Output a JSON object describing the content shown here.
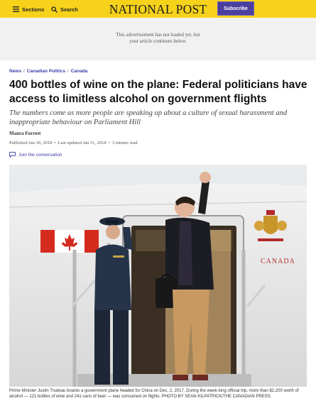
{
  "header": {
    "sections_label": "Sections",
    "search_label": "Search",
    "logo_text": "NATIONAL POST",
    "subscribe_label": "Subscribe",
    "accent_color": "#f6d21b",
    "subscribe_color": "#4b3f9e"
  },
  "ad": {
    "line1": "This advertisement has not loaded yet, but",
    "line2": "your article continues below."
  },
  "breadcrumb": [
    "News",
    "Canadian Politics",
    "Canada"
  ],
  "article": {
    "headline": "400 bottles of wine on the plane: Federal politicians have access to limitless alcohol on government flights",
    "subhead": "The numbers come as more people are speaking up about a culture of sexual harassment and inappropriate behaviour on Parliament Hill",
    "author": "Maura Forrest",
    "published": "Published Jan 30, 2018",
    "updated": "Last updated Jan 31, 2018",
    "read_time": "3 minute read",
    "join_label": "Join the conversation"
  },
  "photo": {
    "plane_label": "CANADA",
    "caption": "Prime Minister Justin Trudeau boards a government plane headed for China on Dec. 2, 2017. During the week-long official trip, more than $2,200 worth of alcohol — 121 bottles of wine and 241 cans of beer — was consumed on flights. PHOTO BY SEAN KILPATRICK/THE CANADIAN PRESS."
  },
  "icons": {
    "menu": "hamburger-icon",
    "search": "magnifier-icon",
    "comment": "speech-bubble-icon"
  }
}
